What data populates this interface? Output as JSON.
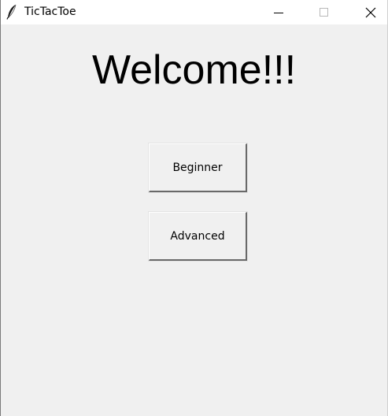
{
  "window": {
    "title": "TicTacToe",
    "controls": {
      "minimize": "minimize-icon",
      "maximize": "maximize-icon",
      "close": "close-icon"
    }
  },
  "main": {
    "heading": "Welcome!!!",
    "buttons": [
      {
        "label": "Beginner"
      },
      {
        "label": "Advanced"
      }
    ]
  },
  "colors": {
    "background": "#f0f0f0",
    "titlebar": "#ffffff",
    "text": "#000000"
  }
}
